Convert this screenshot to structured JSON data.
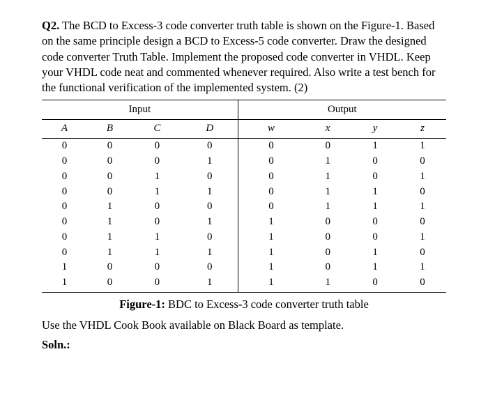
{
  "question": {
    "label": "Q2.",
    "text": " The BCD to Excess-3 code converter truth table is shown on the Figure-1. Based on the same principle design a BCD to Excess-5 code converter. Draw the designed code converter Truth Table. Implement the proposed code converter in VHDL. Keep your VHDL code neat and commented whenever required. Also write a test bench for the functional verification of the implemented system. (2)"
  },
  "chart_data": {
    "type": "table",
    "group_headers": [
      "Input",
      "Output"
    ],
    "columns": [
      "A",
      "B",
      "C",
      "D",
      "w",
      "x",
      "y",
      "z"
    ],
    "rows": [
      [
        "0",
        "0",
        "0",
        "0",
        "0",
        "0",
        "1",
        "1"
      ],
      [
        "0",
        "0",
        "0",
        "1",
        "0",
        "1",
        "0",
        "0"
      ],
      [
        "0",
        "0",
        "1",
        "0",
        "0",
        "1",
        "0",
        "1"
      ],
      [
        "0",
        "0",
        "1",
        "1",
        "0",
        "1",
        "1",
        "0"
      ],
      [
        "0",
        "1",
        "0",
        "0",
        "0",
        "1",
        "1",
        "1"
      ],
      [
        "0",
        "1",
        "0",
        "1",
        "1",
        "0",
        "0",
        "0"
      ],
      [
        "0",
        "1",
        "1",
        "0",
        "1",
        "0",
        "0",
        "1"
      ],
      [
        "0",
        "1",
        "1",
        "1",
        "1",
        "0",
        "1",
        "0"
      ],
      [
        "1",
        "0",
        "0",
        "0",
        "1",
        "0",
        "1",
        "1"
      ],
      [
        "1",
        "0",
        "0",
        "1",
        "1",
        "1",
        "0",
        "0"
      ]
    ]
  },
  "caption": {
    "fig": "Figure-1:",
    "text": " BDC to Excess-3 code converter truth table"
  },
  "footnote": "Use the VHDL Cook Book available on Black Board as template.",
  "soln": "Soln.:"
}
